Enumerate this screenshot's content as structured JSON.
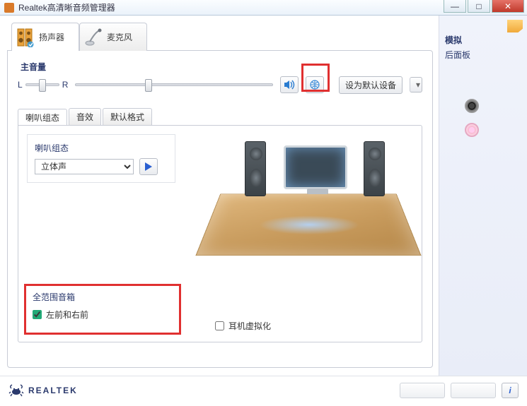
{
  "window": {
    "title": "Realtek高清晰音频管理器"
  },
  "device_tabs": {
    "speaker": "扬声器",
    "mic": "麦克风"
  },
  "volume": {
    "label": "主音量",
    "L": "L",
    "R": "R",
    "balance_pos_pct": 40,
    "master_pos_pct": 35,
    "default_button": "设为默认设备"
  },
  "subtabs": {
    "config": "喇叭组态",
    "effects": "音效",
    "format": "默认格式"
  },
  "speaker_config": {
    "title": "喇叭组态",
    "selected": "立体声",
    "options": [
      "立体声"
    ]
  },
  "full_range": {
    "title": "全范围音箱",
    "front_lr": "左前和右前",
    "front_lr_checked": true
  },
  "headphone_virtualization": {
    "label": "耳机虚拟化",
    "checked": false
  },
  "sidebar": {
    "title": "模拟",
    "sub": "后面板"
  },
  "brand": "REALTEK",
  "icons": {
    "volume": "volume-icon",
    "mute": "globe-icon",
    "info": "i"
  }
}
